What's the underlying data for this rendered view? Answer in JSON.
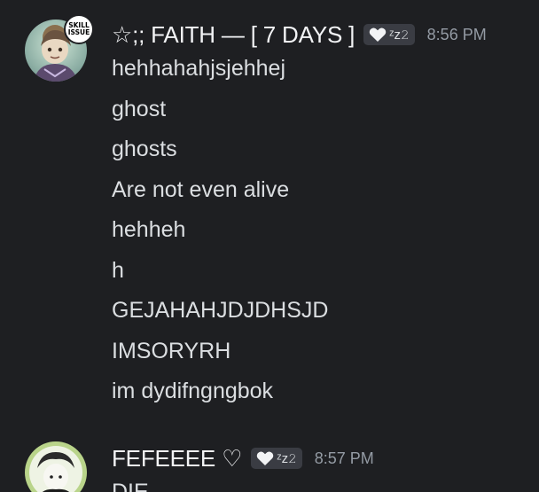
{
  "messages": [
    {
      "username": "☆;; FAITH — [ 7 DAYS ]",
      "tag_text": "ᶻz𝟸",
      "timestamp": "8:56 PM",
      "avatar_badge": [
        "SKILL",
        "ISSUE"
      ],
      "lines": [
        "hehhahahjsjehhej",
        "ghost",
        "ghosts",
        "Are not even alive",
        "hehheh",
        "h",
        "GEJAHAHJDJDHSJD",
        "IMSORYRH",
        "im dydifngngbok"
      ]
    },
    {
      "username": "FEFEEEE ♡",
      "tag_text": "ᶻz𝟸",
      "timestamp": "8:57 PM",
      "lines": [
        "DIE"
      ]
    }
  ],
  "colors": {
    "background": "#1e1f22",
    "username": "#f2f3f5",
    "message_text": "#dbdee1",
    "timestamp": "#949ba4",
    "tag_background": "#3a3c43"
  },
  "icons": {
    "tag_icon": "white-heart-icon"
  }
}
